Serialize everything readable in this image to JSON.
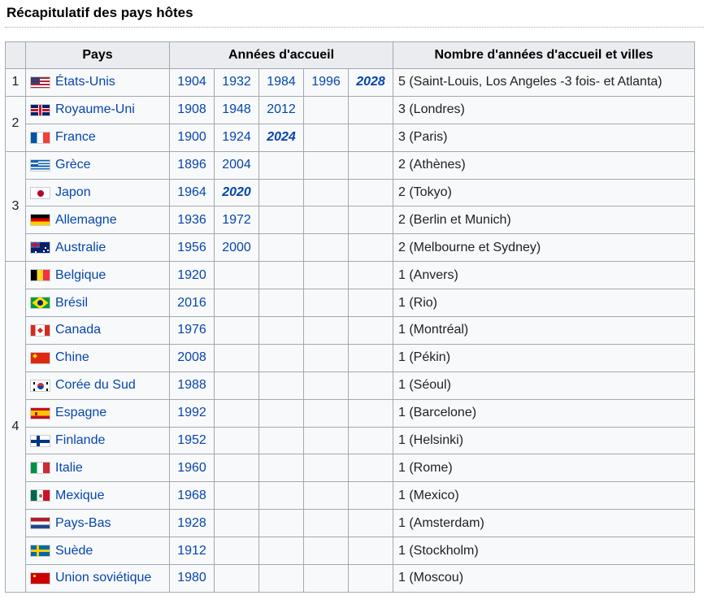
{
  "title": "Récapitulatif des pays hôtes",
  "headers": {
    "pays": "Pays",
    "annees": "Années d'accueil",
    "nombre": "Nombre d'années d'accueil et villes"
  },
  "ranks": [
    "1",
    "2",
    "3",
    "4"
  ],
  "rows": [
    {
      "country": "États-Unis",
      "flag": "usa-flag-icon",
      "years": [
        "1904",
        "1932",
        "1984",
        "1996",
        "2028"
      ],
      "future": [
        false,
        false,
        false,
        false,
        true
      ],
      "count": "5 (Saint-Louis, Los Angeles -3 fois- et Atlanta)"
    },
    {
      "country": "Royaume-Uni",
      "flag": "uk-flag-icon",
      "years": [
        "1908",
        "1948",
        "2012",
        "",
        ""
      ],
      "future": [
        false,
        false,
        false,
        false,
        false
      ],
      "count": "3 (Londres)"
    },
    {
      "country": "France",
      "flag": "france-flag-icon",
      "years": [
        "1900",
        "1924",
        "2024",
        "",
        ""
      ],
      "future": [
        false,
        false,
        true,
        false,
        false
      ],
      "count": "3 (Paris)"
    },
    {
      "country": "Grèce",
      "flag": "greece-flag-icon",
      "years": [
        "1896",
        "2004",
        "",
        "",
        ""
      ],
      "future": [
        false,
        false,
        false,
        false,
        false
      ],
      "count": "2 (Athènes)"
    },
    {
      "country": "Japon",
      "flag": "japan-flag-icon",
      "years": [
        "1964",
        "2020",
        "",
        "",
        ""
      ],
      "future": [
        false,
        true,
        false,
        false,
        false
      ],
      "count": "2 (Tokyo)"
    },
    {
      "country": "Allemagne",
      "flag": "germany-flag-icon",
      "years": [
        "1936",
        "1972",
        "",
        "",
        ""
      ],
      "future": [
        false,
        false,
        false,
        false,
        false
      ],
      "count": "2 (Berlin et Munich)"
    },
    {
      "country": "Australie",
      "flag": "australia-flag-icon",
      "years": [
        "1956",
        "2000",
        "",
        "",
        ""
      ],
      "future": [
        false,
        false,
        false,
        false,
        false
      ],
      "count": "2 (Melbourne et Sydney)"
    },
    {
      "country": "Belgique",
      "flag": "belgium-flag-icon",
      "years": [
        "1920",
        "",
        "",
        "",
        ""
      ],
      "future": [
        false,
        false,
        false,
        false,
        false
      ],
      "count": "1 (Anvers)"
    },
    {
      "country": "Brésil",
      "flag": "brazil-flag-icon",
      "years": [
        "2016",
        "",
        "",
        "",
        ""
      ],
      "future": [
        false,
        false,
        false,
        false,
        false
      ],
      "count": "1 (Rio)"
    },
    {
      "country": "Canada",
      "flag": "canada-flag-icon",
      "years": [
        "1976",
        "",
        "",
        "",
        ""
      ],
      "future": [
        false,
        false,
        false,
        false,
        false
      ],
      "count": "1 (Montréal)"
    },
    {
      "country": "Chine",
      "flag": "china-flag-icon",
      "years": [
        "2008",
        "",
        "",
        "",
        ""
      ],
      "future": [
        false,
        false,
        false,
        false,
        false
      ],
      "count": "1 (Pékin)"
    },
    {
      "country": "Corée du Sud",
      "flag": "south-korea-flag-icon",
      "years": [
        "1988",
        "",
        "",
        "",
        ""
      ],
      "future": [
        false,
        false,
        false,
        false,
        false
      ],
      "count": "1 (Séoul)"
    },
    {
      "country": "Espagne",
      "flag": "spain-flag-icon",
      "years": [
        "1992",
        "",
        "",
        "",
        ""
      ],
      "future": [
        false,
        false,
        false,
        false,
        false
      ],
      "count": "1 (Barcelone)"
    },
    {
      "country": "Finlande",
      "flag": "finland-flag-icon",
      "years": [
        "1952",
        "",
        "",
        "",
        ""
      ],
      "future": [
        false,
        false,
        false,
        false,
        false
      ],
      "count": "1 (Helsinki)"
    },
    {
      "country": "Italie",
      "flag": "italy-flag-icon",
      "years": [
        "1960",
        "",
        "",
        "",
        ""
      ],
      "future": [
        false,
        false,
        false,
        false,
        false
      ],
      "count": "1 (Rome)"
    },
    {
      "country": "Mexique",
      "flag": "mexico-flag-icon",
      "years": [
        "1968",
        "",
        "",
        "",
        ""
      ],
      "future": [
        false,
        false,
        false,
        false,
        false
      ],
      "count": "1 (Mexico)"
    },
    {
      "country": "Pays-Bas",
      "flag": "netherlands-flag-icon",
      "years": [
        "1928",
        "",
        "",
        "",
        ""
      ],
      "future": [
        false,
        false,
        false,
        false,
        false
      ],
      "count": "1 (Amsterdam)"
    },
    {
      "country": "Suède",
      "flag": "sweden-flag-icon",
      "years": [
        "1912",
        "",
        "",
        "",
        ""
      ],
      "future": [
        false,
        false,
        false,
        false,
        false
      ],
      "count": "1 (Stockholm)"
    },
    {
      "country": "Union soviétique",
      "flag": "ussr-flag-icon",
      "years": [
        "1980",
        "",
        "",
        "",
        ""
      ],
      "future": [
        false,
        false,
        false,
        false,
        false
      ],
      "count": "1 (Moscou)"
    }
  ],
  "colors": {
    "link": "#0645ad",
    "header_bg": "#eaecf0",
    "cell_bg": "#f8f9fa",
    "border": "#a2a9b1"
  }
}
